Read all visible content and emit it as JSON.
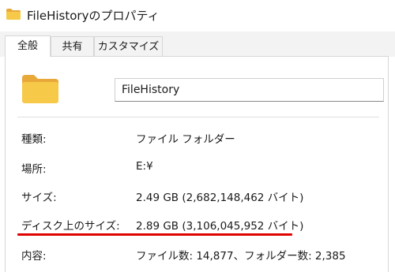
{
  "window": {
    "title": "FileHistoryのプロパティ",
    "icon": "folder-icon"
  },
  "tabs": [
    {
      "label": "全般",
      "active": true
    },
    {
      "label": "共有",
      "active": false
    },
    {
      "label": "カスタマイズ",
      "active": false
    }
  ],
  "general": {
    "folder_name": "FileHistory",
    "rows": [
      {
        "label": "種類:",
        "value": "ファイル フォルダー"
      },
      {
        "label": "場所:",
        "value": "E:¥"
      },
      {
        "label": "サイズ:",
        "value": "2.49 GB (2,682,148,462 バイト)"
      },
      {
        "label": "ディスク上のサイズ:",
        "value": "2.89 GB (3,106,045,952 バイト)"
      },
      {
        "label": "内容:",
        "value": "ファイル数: 14,877、フォルダー数: 2,385"
      }
    ]
  },
  "colors": {
    "folder": "#f7c948",
    "folder_dark": "#e8a93a",
    "highlight_underline": "#e00000"
  }
}
